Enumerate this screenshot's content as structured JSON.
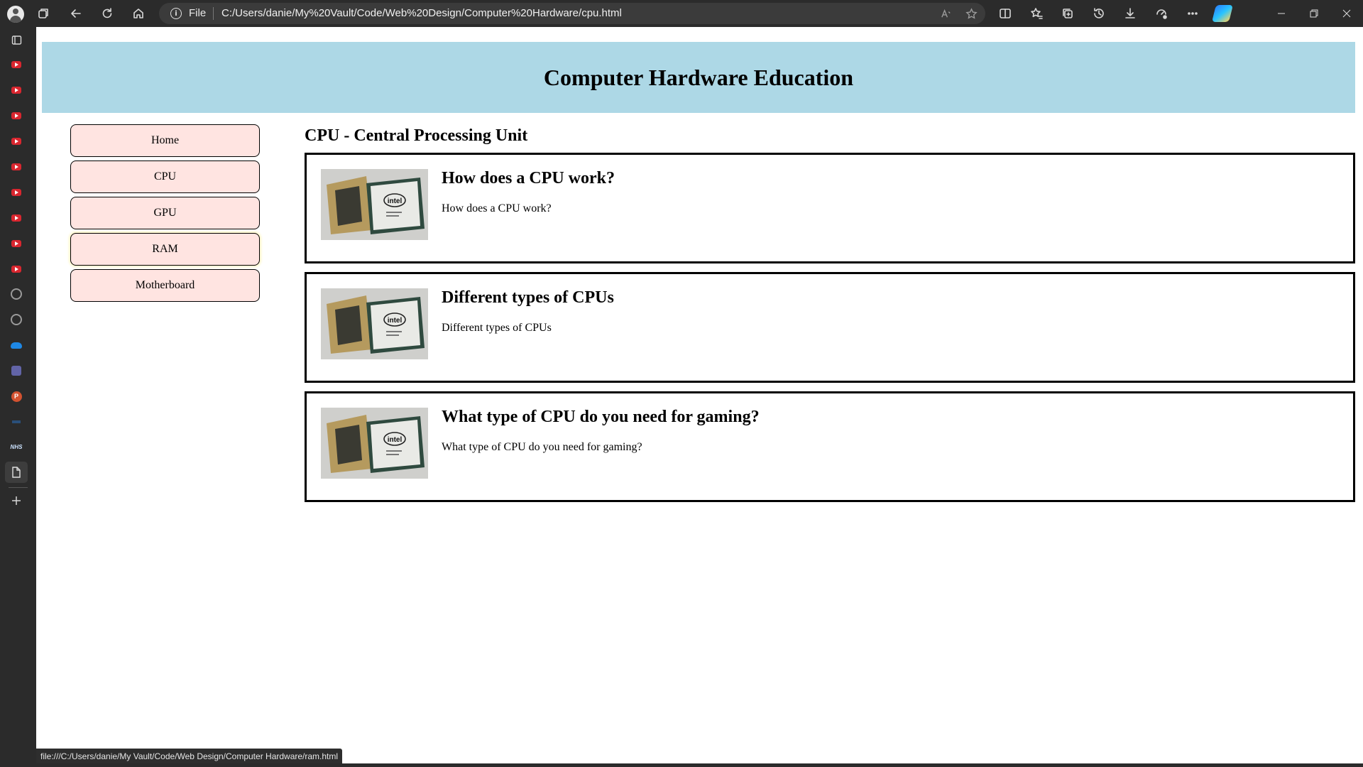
{
  "browser": {
    "address": {
      "scheme_label": "File",
      "url": "C:/Users/danie/My%20Vault/Code/Web%20Design/Computer%20Hardware/cpu.html"
    },
    "status_url": "file:///C:/Users/danie/My Vault/Code/Web Design/Computer Hardware/ram.html",
    "sidebar_icons": [
      "youtube-icon",
      "youtube-icon",
      "youtube-icon",
      "youtube-icon",
      "youtube-icon",
      "youtube-icon",
      "youtube-icon",
      "youtube-icon",
      "youtube-icon",
      "github-icon",
      "github-icon",
      "onedrive-icon",
      "teams-icon",
      "powerpoint-icon",
      "app-icon",
      "nhs-icon",
      "page-icon",
      "add-icon"
    ],
    "powerpoint_letter": "P",
    "nhs_label": "NHS"
  },
  "page": {
    "header_title": "Computer Hardware Education",
    "nav": [
      {
        "label": "Home"
      },
      {
        "label": "CPU"
      },
      {
        "label": "GPU"
      },
      {
        "label": "RAM"
      },
      {
        "label": "Motherboard"
      }
    ],
    "section_title": "CPU - Central Processing Unit",
    "cards": [
      {
        "title": "How does a CPU work?",
        "text": "How does a CPU work?"
      },
      {
        "title": "Different types of CPUs",
        "text": "Different types of CPUs"
      },
      {
        "title": "What type of CPU do you need for gaming?",
        "text": "What type of CPU do you need for gaming?"
      }
    ],
    "cpu_brand_text": "intel"
  },
  "colors": {
    "header_bg": "#add8e6",
    "nav_bg": "#ffe4e1",
    "chrome_bg": "#2b2b2b"
  }
}
